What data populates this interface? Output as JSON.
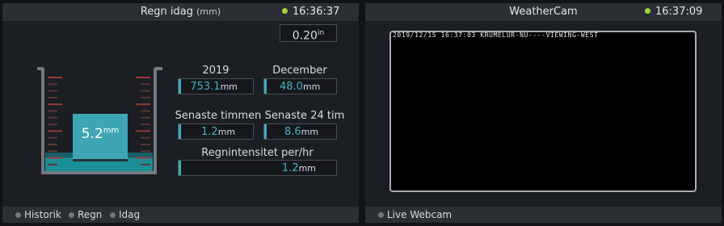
{
  "rain": {
    "title": "Regn idag",
    "title_unit": "(mm)",
    "time": "16:36:37",
    "rate_value": "0.20",
    "rate_unit": "in",
    "gauge_value": "5.2",
    "gauge_unit": "mm",
    "stats": [
      {
        "label": "2019",
        "value": "753.1",
        "unit": "mm"
      },
      {
        "label": "December",
        "value": "48.0",
        "unit": "mm"
      },
      {
        "label": "Senaste timmen",
        "value": "1.2",
        "unit": "mm"
      },
      {
        "label": "Senaste 24 tim",
        "value": "8.6",
        "unit": "mm"
      },
      {
        "label": "Regnintensitet per/hr",
        "value": "1.2",
        "unit": "mm"
      }
    ],
    "footer": [
      "Historik",
      "Regn",
      "Idag"
    ]
  },
  "webcam": {
    "title": "WeatherCam",
    "time": "16:37:09",
    "overlay": "2019/12/15 16:37:03 KRUMELUR-NU----VIEWING-WEST",
    "footer": [
      "Live Webcam"
    ]
  },
  "colors": {
    "accent": "#3fb5c9",
    "status_dot": "#a6d43a",
    "water": "#1b8f98"
  }
}
